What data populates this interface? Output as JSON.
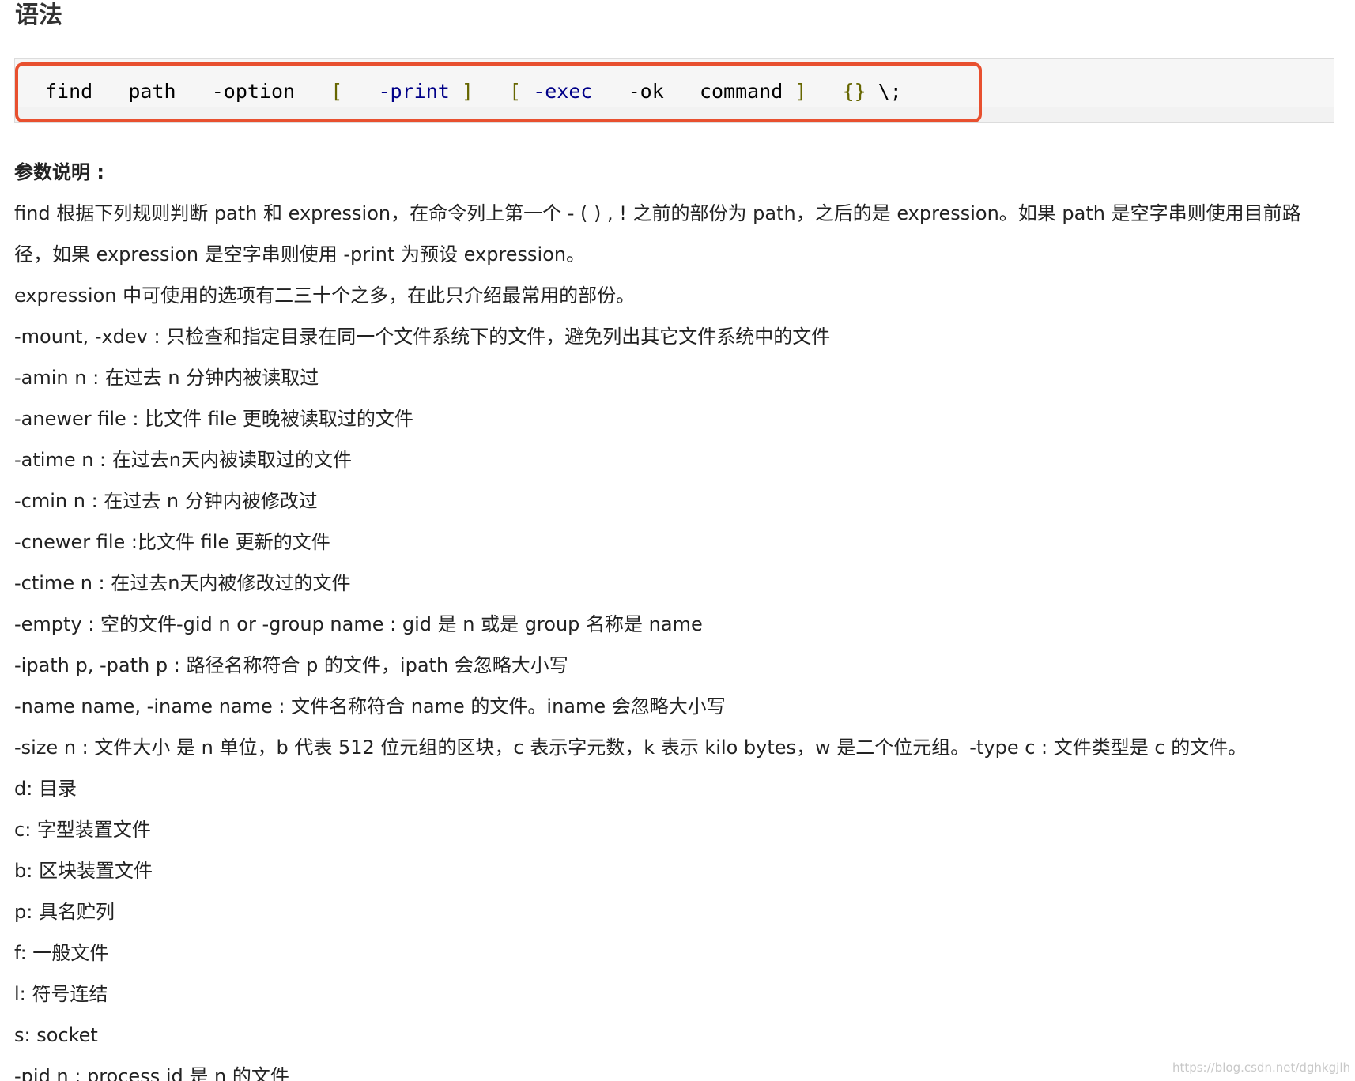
{
  "heading": "语法",
  "code": {
    "t1": "find",
    "t2": "path",
    "t3": "-option",
    "t4": "[",
    "t5": "-print",
    "t6": "]",
    "t7": "[",
    "t8": "-exec",
    "t9": "-ok",
    "t10": "command",
    "t11": "]",
    "t12": "{}",
    "t13": "\\;"
  },
  "section_title": "参数说明 :",
  "lines": {
    "intro": "find 根据下列规则判断 path 和 expression，在命令列上第一个 - ( ) , ! 之前的部份为 path，之后的是 expression。如果 path 是空字串则使用目前路径，如果 expression 是空字串则使用 -print 为预设 expression。",
    "options_note": "expression 中可使用的选项有二三十个之多，在此只介绍最常用的部份。",
    "mount": "-mount, -xdev : 只检查和指定目录在同一个文件系统下的文件，避免列出其它文件系统中的文件",
    "amin": "-amin n : 在过去 n 分钟内被读取过",
    "anewer": "-anewer file : 比文件 file 更晚被读取过的文件",
    "atime": "-atime n : 在过去n天内被读取过的文件",
    "cmin": "-cmin n : 在过去 n 分钟内被修改过",
    "cnewer": "-cnewer file :比文件 file 更新的文件",
    "ctime": "-ctime n : 在过去n天内被修改过的文件",
    "empty": "-empty : 空的文件-gid n or -group name : gid 是 n 或是 group 名称是 name",
    "ipath": "-ipath p, -path p : 路径名称符合 p 的文件，ipath 会忽略大小写",
    "name": "-name name, -iname name : 文件名称符合 name 的文件。iname 会忽略大小写",
    "size": "-size n : 文件大小 是 n 单位，b 代表 512 位元组的区块，c 表示字元数，k 表示 kilo bytes，w 是二个位元组。-type c : 文件类型是 c 的文件。",
    "type_d": "d: 目录",
    "type_c": "c: 字型装置文件",
    "type_b": "b: 区块装置文件",
    "type_p": "p: 具名贮列",
    "type_f": "f: 一般文件",
    "type_l": "l: 符号连结",
    "type_s": "s: socket",
    "pid": "-pid n : process id 是 n 的文件"
  },
  "watermark": "https://blog.csdn.net/dghkgjlh",
  "colors": {
    "highlight_frame": "#e8502f",
    "code_background": "#f6f6f6",
    "code_keyword": "#000088",
    "code_bracket": "#666600"
  }
}
